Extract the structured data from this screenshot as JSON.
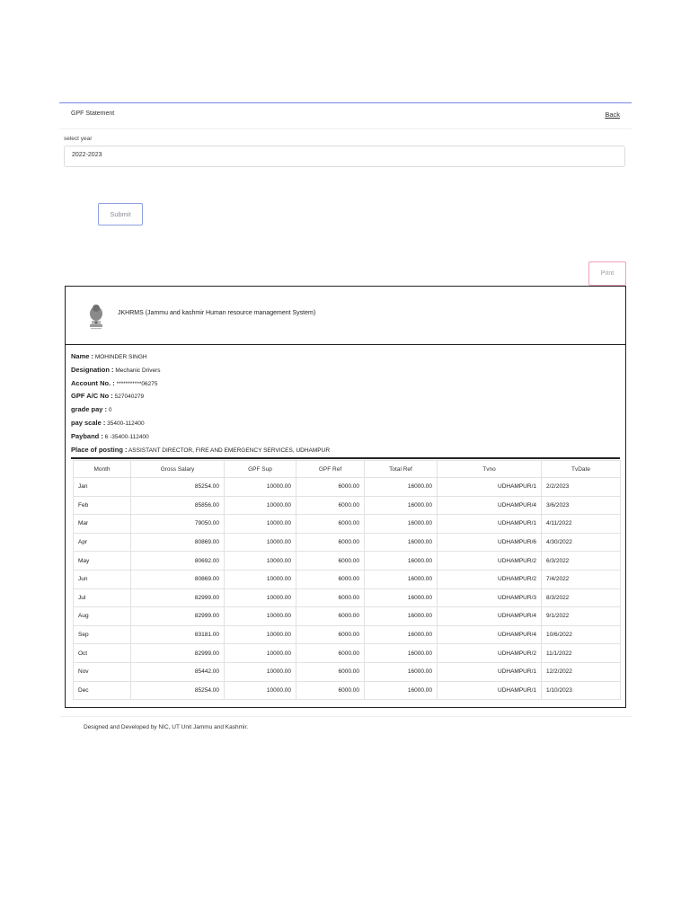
{
  "header": {
    "title": "GPF Statement",
    "back_label": "Back"
  },
  "year_select": {
    "label": "select year",
    "value": "2022-2023"
  },
  "buttons": {
    "submit_label": "Submit",
    "print_label": "Print"
  },
  "report": {
    "system_title": "JKHRMS (Jammu and kashmir Human resource management System)",
    "fields": [
      {
        "label": "Name :",
        "value": "MOHINDER SINGH"
      },
      {
        "label": "Designation :",
        "value": "Mechanic Drivers"
      },
      {
        "label": "Account No. :",
        "value": "***********06275"
      },
      {
        "label": "GPF A/C No :",
        "value": "527040279"
      },
      {
        "label": "grade pay :",
        "value": "0"
      },
      {
        "label": "pay scale :",
        "value": "35400-112400"
      },
      {
        "label": "Payband :",
        "value": "6 -35400-112400"
      },
      {
        "label": "Place of posting :",
        "value": "ASSISTANT DIRECTOR, FIRE AND EMERGENCY SERVICES, UDHAMPUR"
      }
    ],
    "columns": [
      "Month",
      "Gross Salary",
      "GPF Sup",
      "GPF Ref",
      "Total Ref",
      "Tvno",
      "TvDate"
    ],
    "rows": [
      [
        "Jan",
        "85254.00",
        "10000.00",
        "6000.00",
        "16000.00",
        "UDHAMPUR/1",
        "2/2/2023"
      ],
      [
        "Feb",
        "85856.00",
        "10000.00",
        "6000.00",
        "16000.00",
        "UDHAMPUR/4",
        "3/6/2023"
      ],
      [
        "Mar",
        "79050.00",
        "10000.00",
        "6000.00",
        "16000.00",
        "UDHAMPUR/1",
        "4/11/2022"
      ],
      [
        "Apr",
        "80869.00",
        "10000.00",
        "6000.00",
        "16000.00",
        "UDHAMPUR/6",
        "4/30/2022"
      ],
      [
        "May",
        "80692.00",
        "10000.00",
        "6000.00",
        "16000.00",
        "UDHAMPUR/2",
        "6/3/2022"
      ],
      [
        "Jun",
        "80869.00",
        "10000.00",
        "6000.00",
        "16000.00",
        "UDHAMPUR/2",
        "7/4/2022"
      ],
      [
        "Jul",
        "82999.00",
        "10000.00",
        "6000.00",
        "16000.00",
        "UDHAMPUR/3",
        "8/3/2022"
      ],
      [
        "Aug",
        "82999.00",
        "10000.00",
        "6000.00",
        "16000.00",
        "UDHAMPUR/4",
        "9/1/2022"
      ],
      [
        "Sep",
        "83181.00",
        "10000.00",
        "6000.00",
        "16000.00",
        "UDHAMPUR/4",
        "10/6/2022"
      ],
      [
        "Oct",
        "82999.00",
        "10000.00",
        "6000.00",
        "16000.00",
        "UDHAMPUR/2",
        "11/1/2022"
      ],
      [
        "Nov",
        "85442.00",
        "10000.00",
        "6000.00",
        "16000.00",
        "UDHAMPUR/1",
        "12/2/2022"
      ],
      [
        "Dec",
        "85254.00",
        "10000.00",
        "6000.00",
        "16000.00",
        "UDHAMPUR/1",
        "1/10/2023"
      ]
    ]
  },
  "footer": {
    "text": "Designed and Developed by NIC, UT Unit Jammu and Kashmir."
  },
  "icons": {
    "emblem": "national-emblem-icon"
  },
  "colors": {
    "accent": "#7a86e6",
    "submit_border": "#8fa0e0",
    "print_border": "#f0a0b8"
  }
}
